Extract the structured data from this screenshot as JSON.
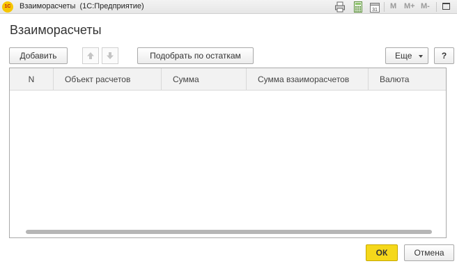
{
  "window": {
    "title": "Взаиморасчеты  (1С:Предприятие)",
    "logo_text": "1С",
    "memory_buttons": [
      "M",
      "M+",
      "M-"
    ],
    "calendar_day": "31"
  },
  "form": {
    "title": "Взаиморасчеты"
  },
  "toolbar": {
    "add_label": "Добавить",
    "pick_label": "Подобрать по остаткам",
    "more_label": "Еще",
    "help_label": "?"
  },
  "table": {
    "columns": [
      "N",
      "Объект расчетов",
      "Сумма",
      "Сумма взаиморасчетов",
      "Валюта"
    ],
    "rows": []
  },
  "footer": {
    "ok_label": "ОК",
    "cancel_label": "Отмена"
  },
  "colors": {
    "ok_button": "#f5d81b",
    "logo": "#f6c600"
  }
}
